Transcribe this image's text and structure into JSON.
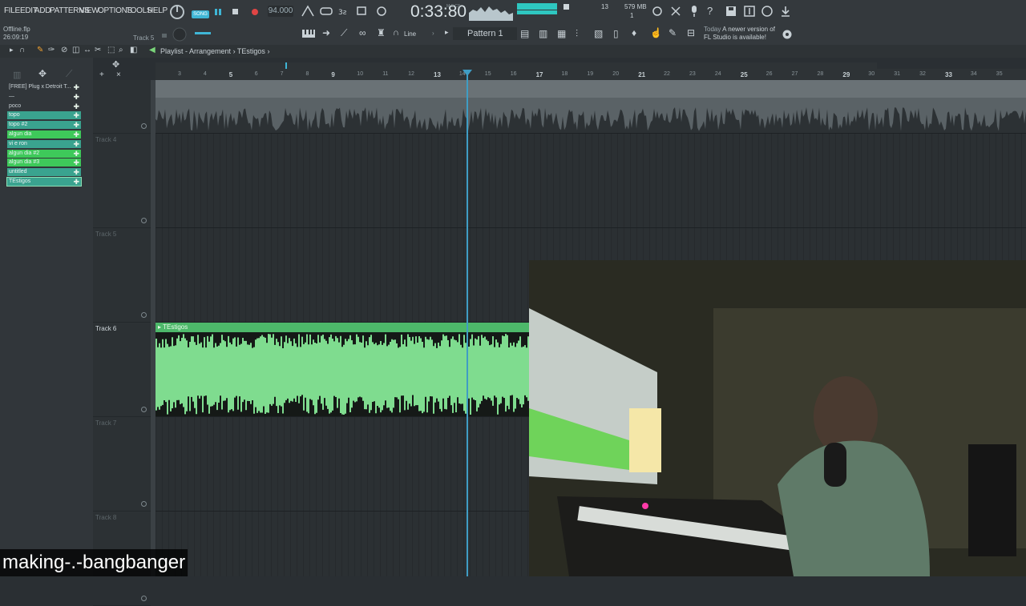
{
  "menu": [
    "FILE",
    "EDIT",
    "ADD",
    "PATTERNS",
    "VIEW",
    "OPTIONS",
    "TOOLS",
    "HELP"
  ],
  "transport": {
    "mode": "SONG",
    "bpm": "94.000",
    "time": "0:33:80",
    "time_unit": "M:S:CS"
  },
  "monitor": {
    "cpu": "13",
    "memory": "579 MB",
    "polyphony": "1"
  },
  "file": {
    "name": "Offline.flp",
    "time": "26:09:19"
  },
  "current_track": "Track 5",
  "snap_label": "Line",
  "pattern": "Pattern 1",
  "news": {
    "prefix": "Today",
    "line1": "A newer version of",
    "line2": "FL Studio is available!"
  },
  "playlist": {
    "title": "Playlist - Arrangement",
    "separator": "›",
    "clip": "TEstigos"
  },
  "left_panel_items": [
    {
      "label": "[FREE] Plug x Detroit T...",
      "style": "plain"
    },
    {
      "label": "—",
      "style": "plain"
    },
    {
      "label": "poco",
      "style": "plain"
    },
    {
      "label": "topo",
      "style": "teal"
    },
    {
      "label": "topo #2",
      "style": "teal"
    },
    {
      "label": "algun dia",
      "style": "green"
    },
    {
      "label": "vi e ron",
      "style": "teal"
    },
    {
      "label": "algun dia #2",
      "style": "green"
    },
    {
      "label": "algun dia #3",
      "style": "green"
    },
    {
      "label": "untitled",
      "style": "teal"
    },
    {
      "label": "TEstigos",
      "style": "sel"
    }
  ],
  "tracks": [
    "",
    "Track 4",
    "Track 5",
    "Track 6",
    "Track 7",
    "Track 8"
  ],
  "timeline_ticks": [
    "3",
    "4",
    "5",
    "6",
    "7",
    "8",
    "9",
    "10",
    "11",
    "12",
    "13",
    "14",
    "15",
    "16",
    "17",
    "18",
    "19",
    "20",
    "21",
    "22",
    "23",
    "24",
    "25",
    "26",
    "27",
    "28",
    "29",
    "30",
    "31",
    "32",
    "33",
    "34",
    "35"
  ],
  "caption": "making-.-bangbanger",
  "colors": {
    "clip": "#7fdc8f",
    "clip_header": "#4db86a",
    "playhead": "#3f9dc4",
    "accent_teal": "#3aa38f",
    "accent_green": "#3ec95a"
  },
  "icons": [
    "wait-icon",
    "metronome-icon",
    "record-icon",
    "play-icon",
    "stop-icon",
    "undo-icon",
    "save-icon",
    "help-icon",
    "mic-icon",
    "download-icon",
    "globe-icon"
  ]
}
